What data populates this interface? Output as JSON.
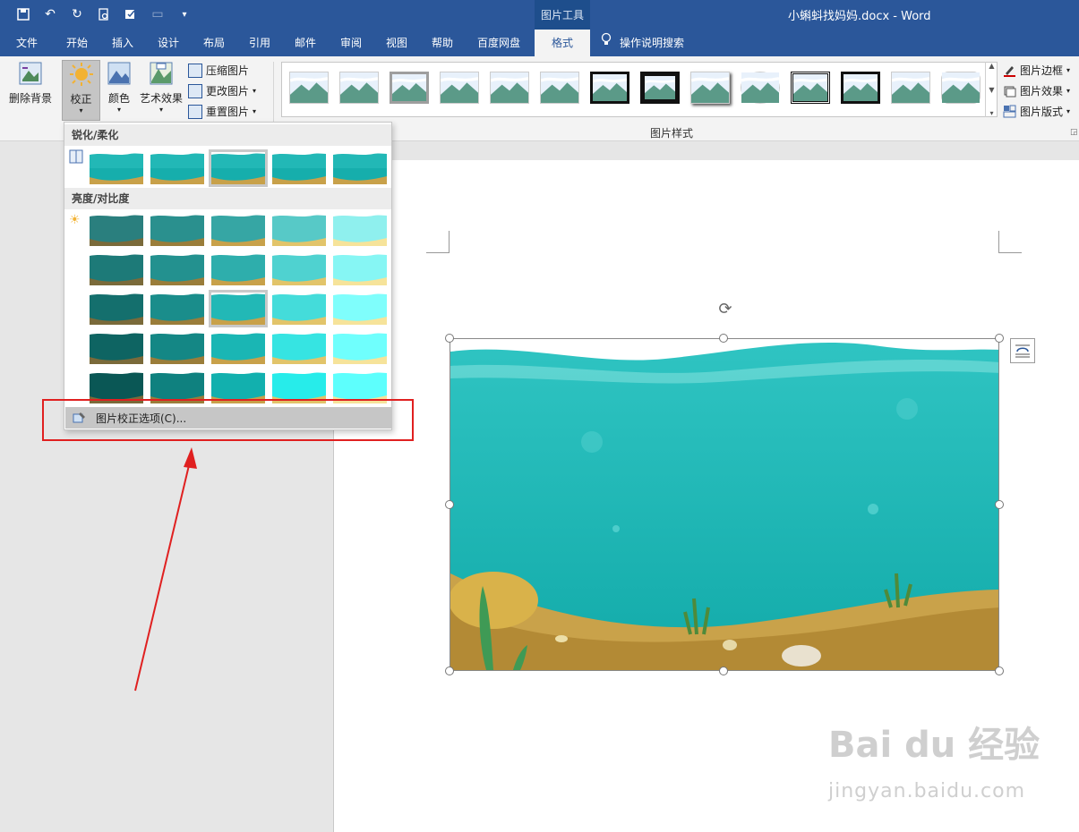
{
  "titlebar": {
    "context_label": "图片工具",
    "doc_title": "小蝌蚪找妈妈.docx - Word",
    "qat_icons": [
      "save-icon",
      "undo-icon",
      "redo-icon",
      "print-preview-icon",
      "spell-check-icon",
      "touch-mode-icon",
      "customize-icon"
    ]
  },
  "tabs": {
    "file": "文件",
    "home": "开始",
    "insert": "插入",
    "design": "设计",
    "layout": "布局",
    "references": "引用",
    "mailings": "邮件",
    "review": "审阅",
    "view": "视图",
    "help": "帮助",
    "baidu": "百度网盘",
    "format": "格式",
    "tell_me": "操作说明搜索"
  },
  "ribbon": {
    "remove_bg": "删除背景",
    "corrections": "校正",
    "color": "颜色",
    "artistic": "艺术效果",
    "compress": "压缩图片",
    "change": "更改图片",
    "reset": "重置图片",
    "border": "图片边框",
    "effects": "图片效果",
    "layout": "图片版式",
    "styles_group_label": "图片样式"
  },
  "dropdown": {
    "sharpen_title": "锐化/柔化",
    "brightness_title": "亮度/对比度",
    "options_label": "图片校正选项(C)..."
  },
  "watermark": {
    "brand": "Bai du 经验",
    "sub": "jingyan.baidu.com"
  },
  "colors": {
    "word_blue": "#2b579a",
    "water": "#19b5b3",
    "sand": "#c9a24a",
    "annotation_red": "#e02020"
  }
}
